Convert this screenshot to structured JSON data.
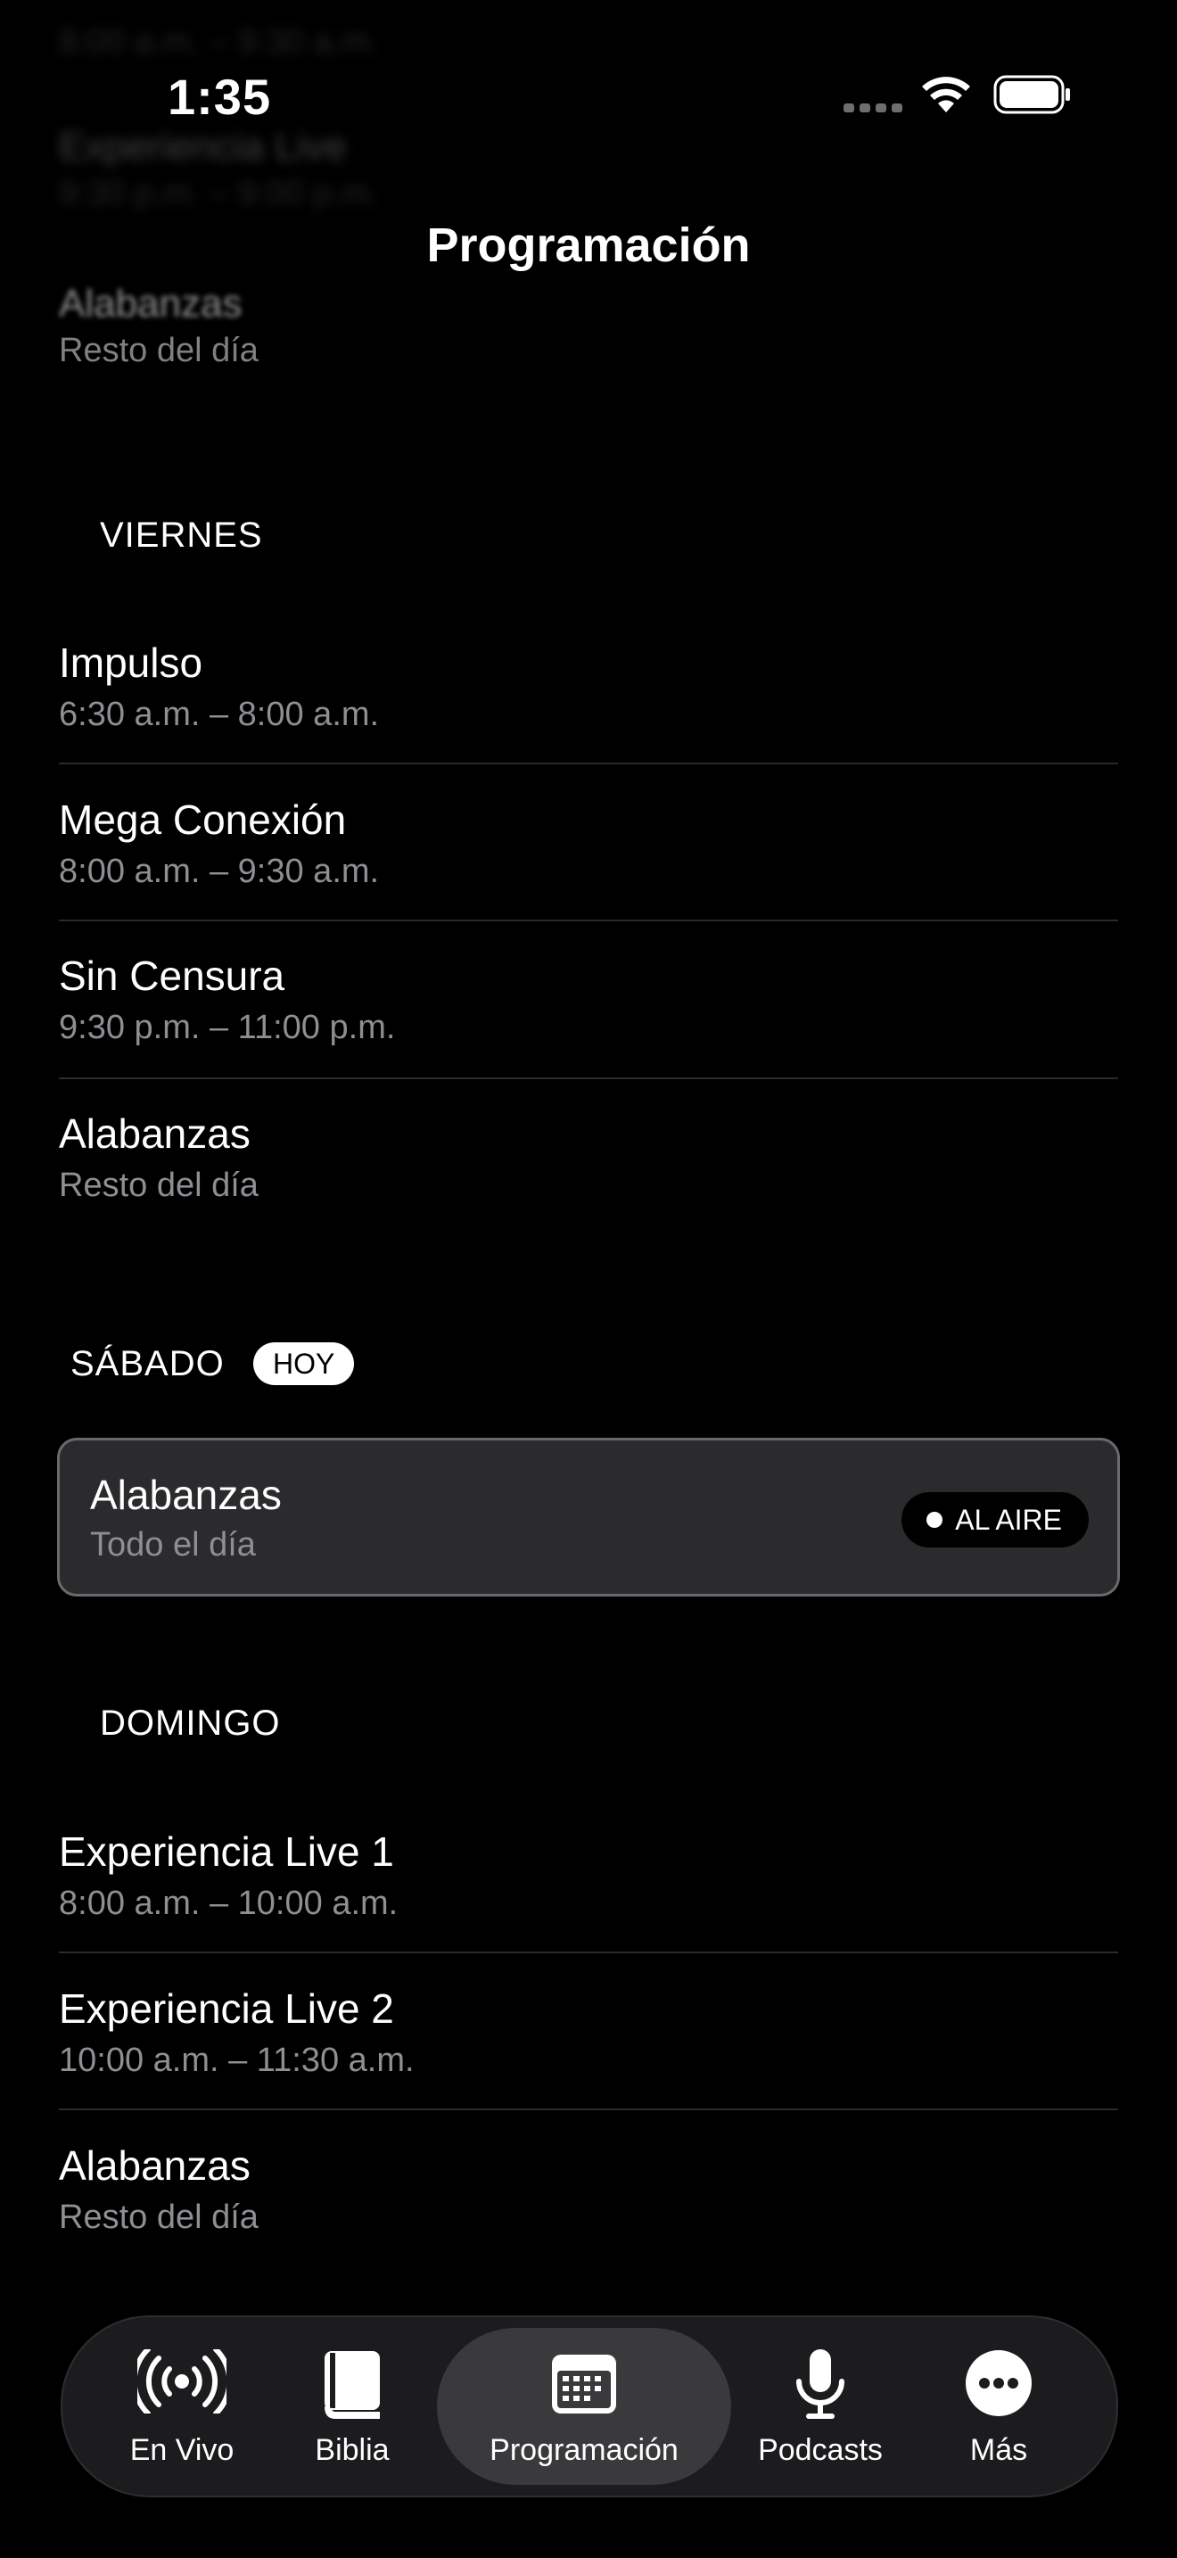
{
  "status_bar": {
    "time": "1:35"
  },
  "nav": {
    "title": "Programación"
  },
  "faded_top": [
    {
      "sub": "8:00 a.m. – 9:30 a.m."
    },
    {
      "title": "Experiencia Live",
      "sub": "9:30 p.m. – 9:00 p.m."
    },
    {
      "title": "Alabanzas",
      "sub": "Resto del día"
    }
  ],
  "viernes": {
    "header": "VIERNES",
    "items": [
      {
        "title": "Impulso",
        "time": "6:30 a.m. – 8:00 a.m."
      },
      {
        "title": "Mega Conexión",
        "time": "8:00 a.m. – 9:30 a.m."
      },
      {
        "title": "Sin Censura",
        "time": "9:30 p.m. – 11:00 p.m."
      },
      {
        "title": "Alabanzas",
        "time": "Resto del día"
      }
    ]
  },
  "sabado": {
    "header": "SÁBADO",
    "badge": "HOY",
    "live": {
      "title": "Alabanzas",
      "time": "Todo el día",
      "status": "AL AIRE"
    }
  },
  "domingo": {
    "header": "DOMINGO",
    "items": [
      {
        "title": "Experiencia Live 1",
        "time": "8:00 a.m. – 10:00 a.m."
      },
      {
        "title": "Experiencia Live 2",
        "time": "10:00 a.m. – 11:30 a.m."
      },
      {
        "title": "Alabanzas",
        "time": "Resto del día"
      }
    ]
  },
  "tabbar": {
    "tabs": [
      {
        "label": "En Vivo",
        "icon": "broadcast-icon"
      },
      {
        "label": "Biblia",
        "icon": "book-icon"
      },
      {
        "label": "Programación",
        "icon": "calendar-icon",
        "active": true
      },
      {
        "label": "Podcasts",
        "icon": "microphone-icon"
      },
      {
        "label": "Más",
        "icon": "more-icon"
      }
    ]
  },
  "colors": {
    "background": "#000000",
    "secondary_text": "#8e8e93",
    "card": "#2b2b2d",
    "tabbar": "#1c1c1e",
    "active_tab": "#3a3a3c"
  }
}
